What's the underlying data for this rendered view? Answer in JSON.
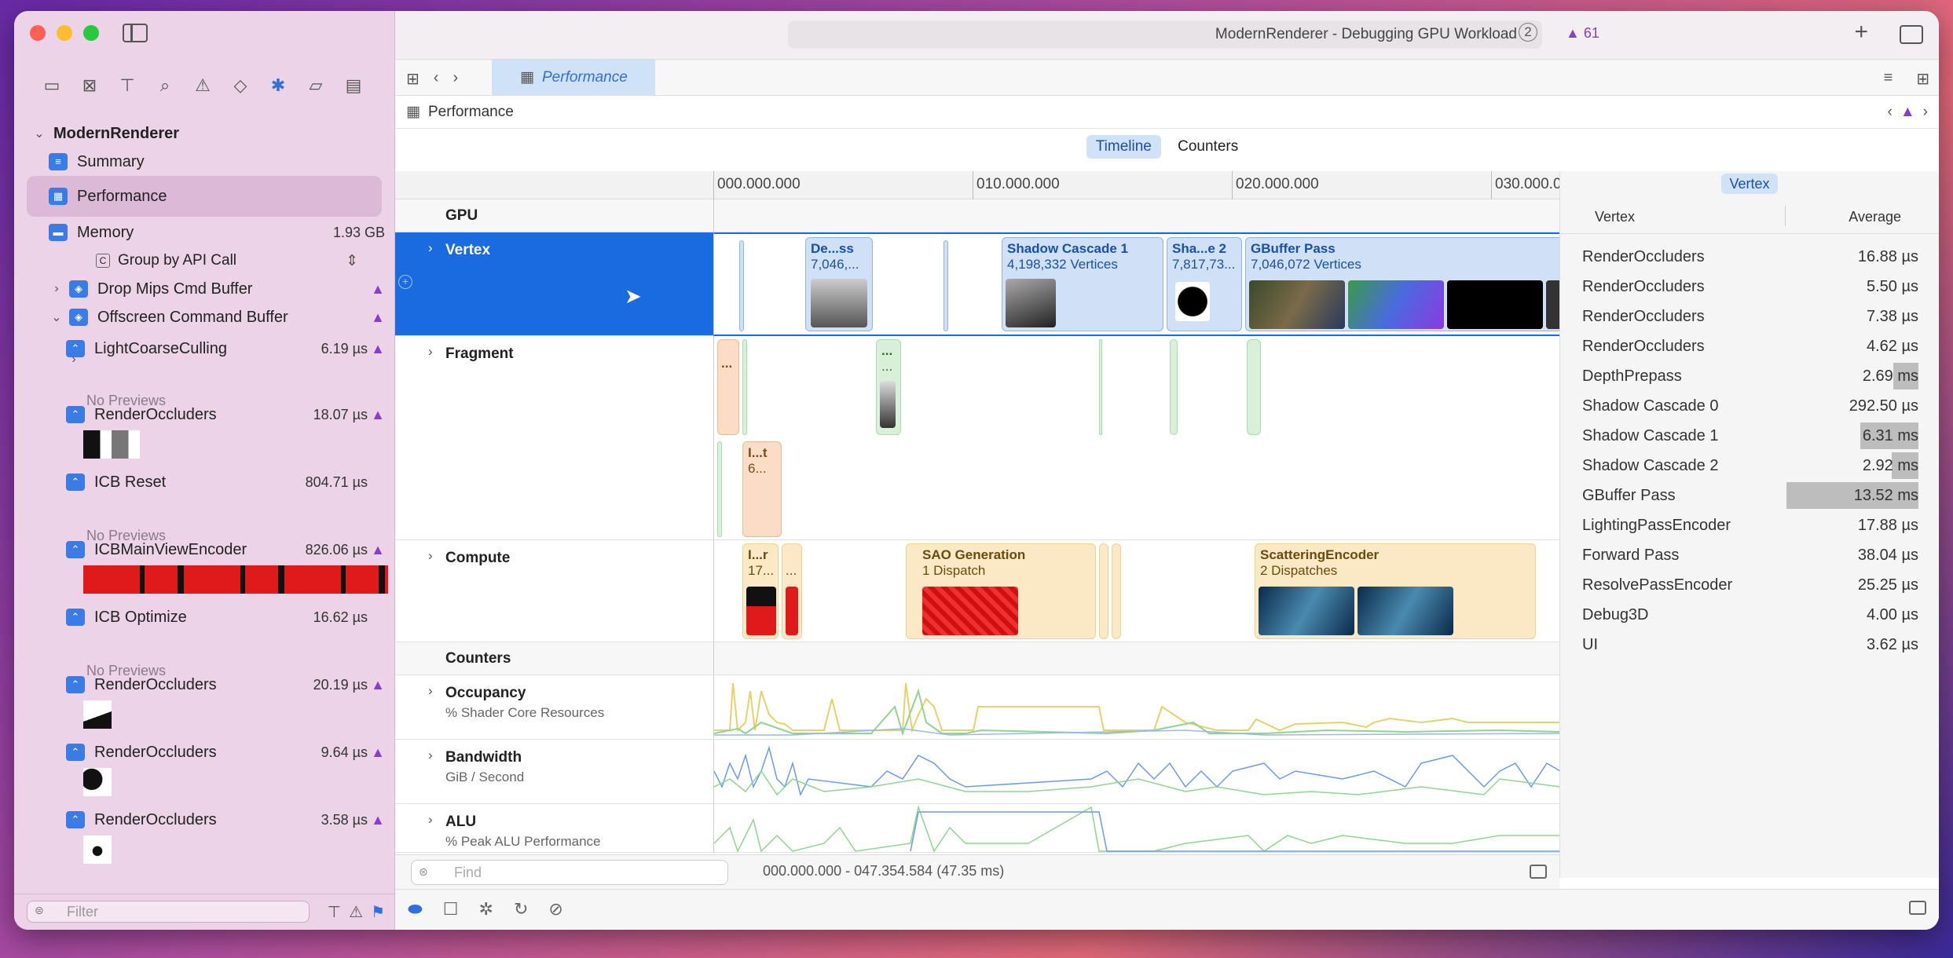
{
  "window": {
    "title": "ModernRenderer - Debugging GPU Workload",
    "title_badge": "2",
    "warning_count": "61"
  },
  "tabs": {
    "active": "Performance"
  },
  "breadcrumb": {
    "label": "Performance"
  },
  "segmented": {
    "timeline": "Timeline",
    "counters": "Counters",
    "selected": "Timeline"
  },
  "sidebar": {
    "project": "ModernRenderer",
    "summary": "Summary",
    "performance": "Performance",
    "memory": "Memory",
    "memory_value": "1.93 GB",
    "group_by": "Group by API Call",
    "drop_mips": "Drop Mips Cmd Buffer",
    "offscreen": "Offscreen Command Buffer",
    "items": [
      {
        "label": "LightCoarseCulling",
        "value": "6.19 µs",
        "warn": true,
        "preview": "No Previews"
      },
      {
        "label": "RenderOccluders",
        "value": "18.07 µs",
        "warn": true,
        "preview": ""
      },
      {
        "label": "ICB Reset",
        "value": "804.71 µs",
        "warn": false,
        "preview": "No Previews"
      },
      {
        "label": "ICBMainViewEncoder",
        "value": "826.06 µs",
        "warn": true,
        "preview": ""
      },
      {
        "label": "ICB Optimize",
        "value": "16.62 µs",
        "warn": false,
        "preview": "No Previews"
      },
      {
        "label": "RenderOccluders",
        "value": "20.19 µs",
        "warn": true,
        "preview": ""
      },
      {
        "label": "RenderOccluders",
        "value": "9.64 µs",
        "warn": true,
        "preview": ""
      },
      {
        "label": "RenderOccluders",
        "value": "3.58 µs",
        "warn": true,
        "preview": ""
      }
    ],
    "filter_placeholder": "Filter"
  },
  "timeline": {
    "ruler": [
      "000.000.000",
      "010.000.000",
      "020.000.000",
      "030.000.0"
    ],
    "gpu_label": "GPU",
    "tracks": {
      "vertex": "Vertex",
      "fragment": "Fragment",
      "compute": "Compute",
      "counters": "Counters",
      "occupancy": "Occupancy",
      "occupancy_sub": "% Shader Core Resources",
      "bandwidth": "Bandwidth",
      "bandwidth_sub": "GiB / Second",
      "alu": "ALU",
      "alu_sub": "% Peak ALU Performance"
    },
    "vertex_blocks": [
      {
        "t1": "De...ss",
        "t2": "7,046,..."
      },
      {
        "t1": "Shadow Cascade 1",
        "t2": "4,198,332 Vertices"
      },
      {
        "t1": "Sha...e 2",
        "t2": "7,817,73..."
      },
      {
        "t1": "GBuffer Pass",
        "t2": "7,046,072 Vertices"
      }
    ],
    "fragment_blocks": [
      {
        "t1": "...",
        "t2": ""
      },
      {
        "t1": "...",
        "t2": "..."
      },
      {
        "t1": "I...t",
        "t2": "6..."
      }
    ],
    "compute_blocks": [
      {
        "t1": "I...r",
        "t2": "17..."
      },
      {
        "t1": "",
        "t2": "..."
      },
      {
        "t1": "SAO Generation",
        "t2": "1 Dispatch"
      },
      {
        "t1": "ScatteringEncoder",
        "t2": "2 Dispatches"
      }
    ]
  },
  "find": {
    "placeholder": "Find",
    "range": "000.000.000 - 047.354.584 (47.35 ms)"
  },
  "inspector": {
    "tab": "Vertex",
    "col1": "Vertex",
    "col2": "Average",
    "rows": [
      {
        "name": "RenderOccluders",
        "value": "16.88 µs"
      },
      {
        "name": "RenderOccluders",
        "value": "5.50 µs"
      },
      {
        "name": "RenderOccluders",
        "value": "7.38 µs"
      },
      {
        "name": "RenderOccluders",
        "value": "4.62 µs"
      },
      {
        "name": "DepthPrepass",
        "value": "2.69 ms"
      },
      {
        "name": "Shadow Cascade 0",
        "value": "292.50 µs"
      },
      {
        "name": "Shadow Cascade 1",
        "value": "6.31 ms"
      },
      {
        "name": "Shadow Cascade 2",
        "value": "2.92 ms"
      },
      {
        "name": "GBuffer Pass",
        "value": "13.52 ms"
      },
      {
        "name": "LightingPassEncoder",
        "value": "17.88 µs"
      },
      {
        "name": "Forward Pass",
        "value": "38.04 µs"
      },
      {
        "name": "ResolvePassEncoder",
        "value": "25.25 µs"
      },
      {
        "name": "Debug3D",
        "value": "4.00 µs"
      },
      {
        "name": "UI",
        "value": "3.62 µs"
      }
    ]
  },
  "colors": {
    "accent": "#1a6be0",
    "sidebar_bg": "#ecd3e8",
    "warning": "#8a3ccf"
  }
}
